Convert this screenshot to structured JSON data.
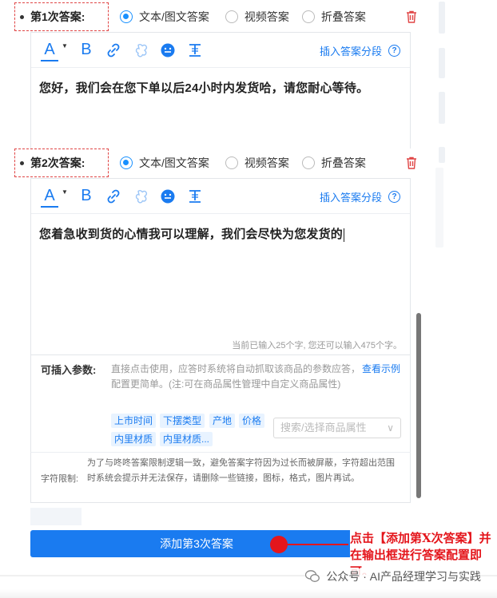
{
  "answers": [
    {
      "label": "第1次答案:",
      "options": [
        "文本/图文答案",
        "视频答案",
        "折叠答案"
      ],
      "selected": 0,
      "insert_segment": "插入答案分段",
      "content": "您好，我们会在您下单以后24小时内发货哈，请您耐心等待。"
    },
    {
      "label": "第2次答案:",
      "options": [
        "文本/图文答案",
        "视频答案",
        "折叠答案"
      ],
      "selected": 0,
      "insert_segment": "插入答案分段",
      "content": "您着急收到货的心情我可以理解，我们会尽快为您发货的",
      "counter": "当前已输入25个字, 您还可以输入475个字。"
    }
  ],
  "toolbar": {
    "font_color": "A",
    "bold": "B",
    "help": "?"
  },
  "params": {
    "label": "可插入参数:",
    "description": "直接点击使用，应答时系统将自动抓取该商品的参数应答，配置更简单。(注:可在商品属性管理中自定义商品属性)",
    "example_link": "查看示例",
    "tags": [
      "上市时间",
      "下摆类型",
      "产地",
      "价格",
      "内里材质",
      "内里材质..."
    ],
    "select_placeholder": "搜索/选择商品属性",
    "chevron": "∨"
  },
  "limit": {
    "label": "字符限制:",
    "text": "为了与咚咚答案限制逻辑一致，避免答案字符因为过长而被屏蔽，字符超出范围时系统会提示并无法保存，请删除一些链接，图标，格式，图片再试。"
  },
  "add_button": "添加第3次答案",
  "callout": "点击【添加第X次答案】并在输出框进行答案配置即可。",
  "watermark": "公众号 · AI产品经理学习与实践",
  "colors": {
    "accent": "#1a7bf0",
    "annotation_red": "#e4161c",
    "dashed_border": "#e04545"
  }
}
